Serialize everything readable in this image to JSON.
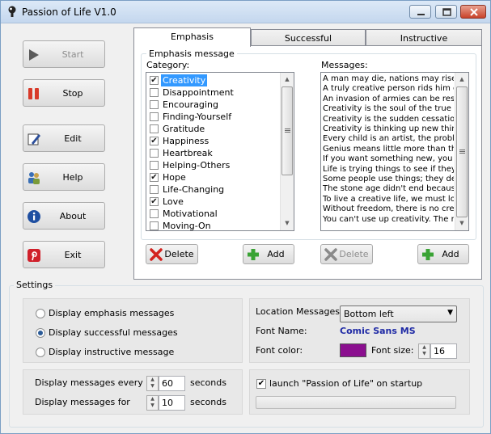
{
  "window": {
    "title": "Passion of Life V1.0"
  },
  "left_buttons": {
    "start": "Start",
    "stop": "Stop",
    "edit": "Edit",
    "help": "Help",
    "about": "About",
    "exit": "Exit"
  },
  "tabs": [
    "Emphasis",
    "Successful",
    "Instructive"
  ],
  "emphasis": {
    "group_title": "Emphasis message",
    "category_label": "Category:",
    "messages_label": "Messages:",
    "categories": [
      {
        "label": "Creativity",
        "checked": true,
        "selected": true
      },
      {
        "label": "Disappointment",
        "checked": false,
        "selected": false
      },
      {
        "label": "Encouraging",
        "checked": false,
        "selected": false
      },
      {
        "label": "Finding-Yourself",
        "checked": false,
        "selected": false
      },
      {
        "label": "Gratitude",
        "checked": false,
        "selected": false
      },
      {
        "label": "Happiness",
        "checked": true,
        "selected": false
      },
      {
        "label": "Heartbreak",
        "checked": false,
        "selected": false
      },
      {
        "label": "Helping-Others",
        "checked": false,
        "selected": false
      },
      {
        "label": "Hope",
        "checked": true,
        "selected": false
      },
      {
        "label": "Life-Changing",
        "checked": false,
        "selected": false
      },
      {
        "label": "Love",
        "checked": true,
        "selected": false
      },
      {
        "label": "Motivational",
        "checked": false,
        "selected": false
      },
      {
        "label": "Moving-On",
        "checked": false,
        "selected": false
      }
    ],
    "messages": [
      "A man may die, nations may rise ar",
      "A truly creative person rids him or h",
      "An invasion of armies can be resist",
      "Creativity is the soul of the true sch",
      "Creativity is the sudden cessation c",
      "Creativity is thinking up new things",
      "Every child is an artist, the problem",
      "Genius means little more than the f",
      "If you want something new, you ha",
      "Life is trying things to see if they w",
      "Some people use things; they dest",
      "The stone age didn't end because",
      "To live a creative life, we must lose",
      "Without freedom, there is no creati",
      "You can't use up creativity. The m"
    ],
    "delete_label": "Delete",
    "add_label": "Add"
  },
  "settings": {
    "title": "Settings",
    "radios": [
      {
        "label": "Display emphasis messages",
        "selected": false
      },
      {
        "label": "Display successful messages",
        "selected": true
      },
      {
        "label": "Display instructive message",
        "selected": false
      }
    ],
    "location_label": "Location Messages:",
    "location_value": "Bottom left",
    "font_name_label": "Font Name:",
    "font_name_value": "Comic Sans MS",
    "font_name_color": "#1f2aa5",
    "font_color_label": "Font color:",
    "font_color_swatch": "#8b0f8f",
    "font_size_label": "Font size:",
    "font_size_value": "16",
    "every_label": "Display messages every",
    "every_value": "60",
    "every_unit": "seconds",
    "for_label": "Display messages for",
    "for_value": "10",
    "for_unit": "seconds",
    "startup_label": "launch \"Passion of Life\" on startup",
    "startup_checked": true,
    "progress_fraction": 0
  }
}
